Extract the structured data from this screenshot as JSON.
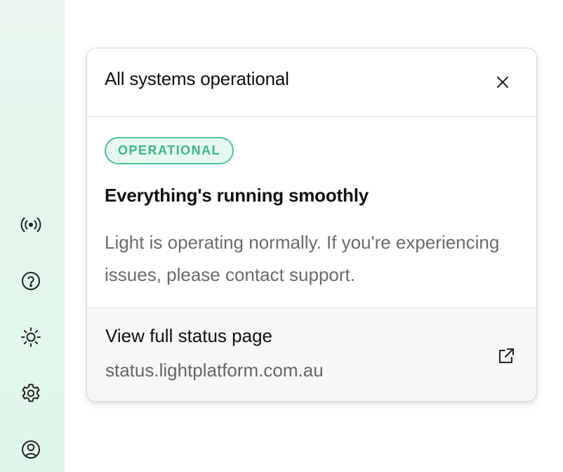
{
  "sidebar": {
    "items": [
      {
        "icon": "broadcast-icon"
      },
      {
        "icon": "help-icon"
      },
      {
        "icon": "sun-icon"
      },
      {
        "icon": "gear-icon"
      },
      {
        "icon": "account-icon"
      }
    ]
  },
  "status_panel": {
    "title": "All systems operational",
    "badge": "OPERATIONAL",
    "headline": "Everything's running smoothly",
    "description": "Light is operating normally. If you're experiencing issues, please contact support.",
    "footer": {
      "title": "View full status page",
      "url": "status.lightplatform.com.au"
    }
  },
  "colors": {
    "sidebar_bg": "#e6f6ee",
    "status_green": "#3db885",
    "badge_bg": "#e6f8f0"
  }
}
